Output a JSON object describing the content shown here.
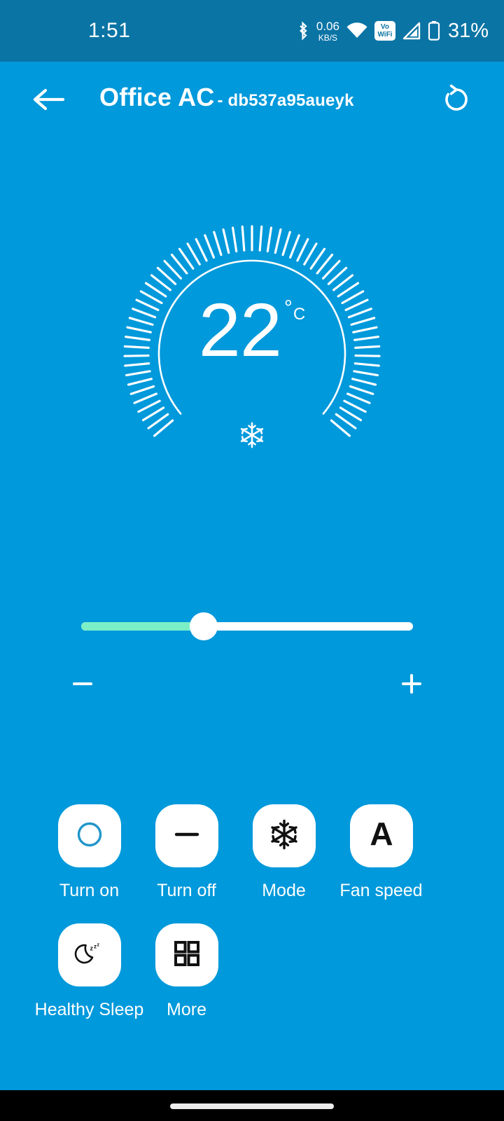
{
  "theme": {
    "background": "#0099DB",
    "status_bar_background": "#0A74A5",
    "accent_white": "#FFFFFF",
    "slider_fill": "#7BF0C6",
    "power_icon_blue": "#2196C9",
    "nav_bar_background": "#000000"
  },
  "status_bar": {
    "time": "1:51",
    "bluetooth_icon": "bluetooth-icon",
    "network_rate_value": "0.06",
    "network_rate_unit": "KB/S",
    "wifi_icon": "wifi-icon",
    "vowifi_line1": "Vo",
    "vowifi_line2": "WiFi",
    "signal_icon": "cellular-signal-icon",
    "battery_icon": "battery-icon",
    "battery_percent": "31%"
  },
  "app_bar": {
    "back_icon": "back-arrow-icon",
    "device_name": "Office AC",
    "device_id": "- db537a95aueyk",
    "refresh_icon": "refresh-icon"
  },
  "dial": {
    "temperature": "22",
    "degree_symbol": "°",
    "unit": "C",
    "mode_icon": "snowflake-icon",
    "tick_count": 61,
    "arc_gap_degrees": 100
  },
  "slider": {
    "value_percent": 37,
    "min_label": "−",
    "max_label": "+",
    "decrease_icon": "minus-icon",
    "increase_icon": "plus-icon"
  },
  "actions": {
    "row1": [
      {
        "label": "Turn on",
        "icon": "power-on-icon"
      },
      {
        "label": "Turn off",
        "icon": "power-off-icon"
      },
      {
        "label": "Mode",
        "icon": "snowflake-icon"
      },
      {
        "label": "Fan speed",
        "icon": "auto-fan-a-icon"
      }
    ],
    "row2": [
      {
        "label": "Healthy Sleep",
        "icon": "moon-zzz-icon"
      },
      {
        "label": "More",
        "icon": "grid-squares-icon"
      }
    ]
  },
  "nav_bar": {
    "gesture_pill": "home-gesture-pill"
  }
}
